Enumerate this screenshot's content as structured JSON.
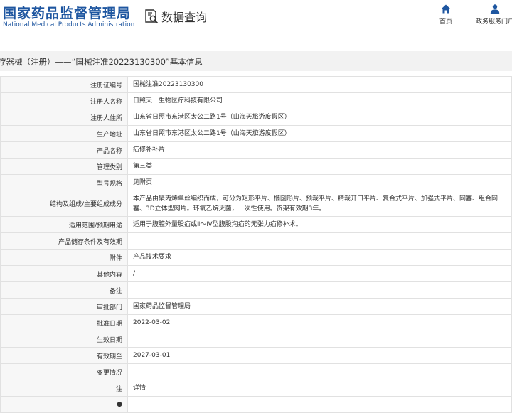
{
  "header": {
    "logo_cn": "国家药品监督管理局",
    "logo_en": "National Medical Products Administration",
    "search_title": "数据查询",
    "nav": [
      {
        "label": "首页",
        "icon": "home-icon"
      },
      {
        "label": "政务服务门户",
        "icon": "user-icon"
      }
    ]
  },
  "page_title": "疗器械（注册）——“国械注准20223130300”基本信息",
  "rows": [
    {
      "label": "注册证编号",
      "value": "国械注准20223130300"
    },
    {
      "label": "注册人名称",
      "value": "日照天一生物医疗科技有限公司"
    },
    {
      "label": "注册人住所",
      "value": "山东省日照市东港区太公二路1号（山海天旅游度假区）"
    },
    {
      "label": "生产地址",
      "value": "山东省日照市东港区太公二路1号（山海天旅游度假区）"
    },
    {
      "label": "产品名称",
      "value": "疝修补补片"
    },
    {
      "label": "管理类别",
      "value": "第三类"
    },
    {
      "label": "型号规格",
      "value": "见附页"
    },
    {
      "label": "结构及组成/主要组成成分",
      "value": "本产品由聚丙烯单丝编织而成，可分为矩形平片、椭圆形片、预裁平片、精裁开口平片、复合式平片、加强式平片、网塞、组合网塞、3D立体型网片。环氧乙烷灭菌，一次性使用。货架有效期3年。"
    },
    {
      "label": "适用范围/预期用途",
      "value": "适用于腹腔外量股疝或Ⅱ～Ⅳ型腹股沟疝的无张力疝修补术。"
    },
    {
      "label": "产品储存条件及有效期",
      "value": ""
    },
    {
      "label": "附件",
      "value": "产品技术要求"
    },
    {
      "label": "其他内容",
      "value": "/"
    },
    {
      "label": "备注",
      "value": ""
    },
    {
      "label": "审批部门",
      "value": "国家药品监督管理局"
    },
    {
      "label": "批准日期",
      "value": "2022-03-02"
    },
    {
      "label": "生效日期",
      "value": ""
    },
    {
      "label": "有效期至",
      "value": "2027-03-01"
    },
    {
      "label": "变更情况",
      "value": ""
    },
    {
      "label": "注",
      "value": "详情"
    }
  ],
  "colors": {
    "brand": "#1e56a0",
    "link": "#1a5bb5",
    "label_bg": "#f7f7f7",
    "title_bg": "#f2f2f2"
  }
}
